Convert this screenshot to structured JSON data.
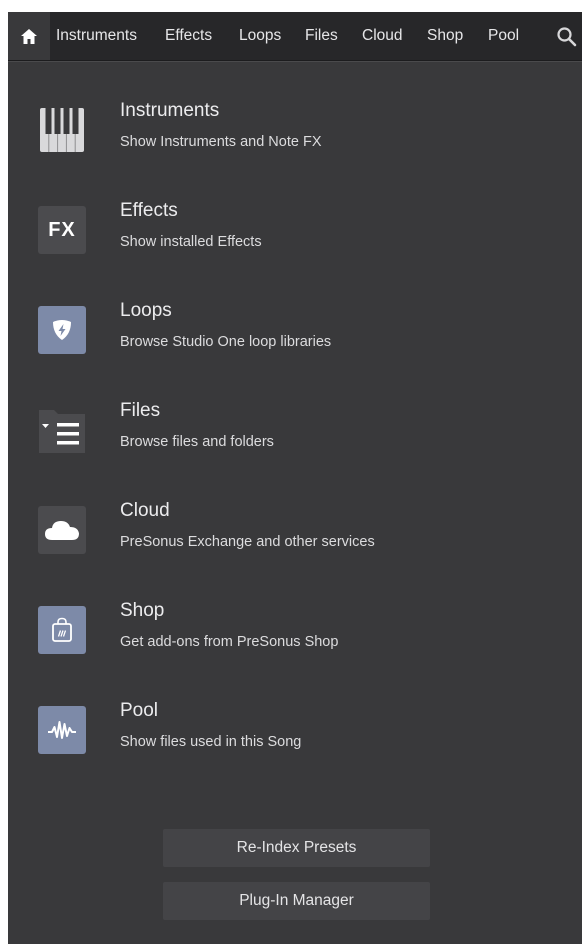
{
  "nav": {
    "items": [
      {
        "label": "Instruments"
      },
      {
        "label": "Effects"
      },
      {
        "label": "Loops"
      },
      {
        "label": "Files"
      },
      {
        "label": "Cloud"
      },
      {
        "label": "Shop"
      },
      {
        "label": "Pool"
      }
    ],
    "home_icon": "home-icon",
    "search_icon": "search-icon"
  },
  "entries": [
    {
      "title": "Instruments",
      "description": "Show Instruments and Note FX",
      "icon": "piano-keys-icon"
    },
    {
      "title": "Effects",
      "description": "Show installed Effects",
      "icon": "fx-icon",
      "icon_text": "FX"
    },
    {
      "title": "Loops",
      "description": "Browse Studio One loop libraries",
      "icon": "loops-icon"
    },
    {
      "title": "Files",
      "description": "Browse files and folders",
      "icon": "files-icon"
    },
    {
      "title": "Cloud",
      "description": "PreSonus Exchange and other services",
      "icon": "cloud-icon"
    },
    {
      "title": "Shop",
      "description": "Get add-ons from PreSonus Shop",
      "icon": "shop-bag-icon"
    },
    {
      "title": "Pool",
      "description": "Show files used in this Song",
      "icon": "pool-waveform-icon"
    }
  ],
  "buttons": {
    "reindex": "Re-Index Presets",
    "plugin_manager": "Plug-In Manager"
  },
  "colors": {
    "background": "#39393b",
    "topbar": "#272729",
    "icon_dark": "#4b4b4e",
    "icon_blue": "#7d8aa8",
    "text": "#ececee"
  }
}
